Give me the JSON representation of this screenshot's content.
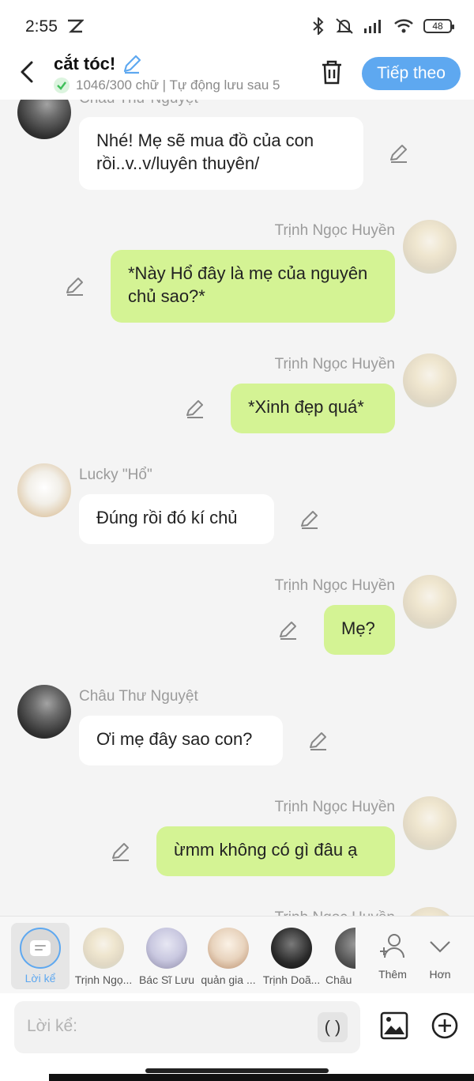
{
  "status_bar": {
    "time": "2:55",
    "battery": "48"
  },
  "header": {
    "title": "cắt tóc!",
    "subtitle": "1046/300 chữ | Tự động lưu sau 5",
    "next_button": "Tiếp theo"
  },
  "chat": {
    "top_partial_name": "Châu Thư Nguyệt",
    "messages": [
      {
        "side": "left",
        "name": "",
        "text": "Nhé! Mẹ sẽ mua đồ của con rồi..v..v/luyên thuyên/",
        "avatar": "avatar-dark"
      },
      {
        "side": "right",
        "name": "Trịnh Ngọc Huyền",
        "text": "*Này Hổ đây là mẹ của nguyên chủ sao?*",
        "avatar": "avatar-light"
      },
      {
        "side": "right",
        "name": "Trịnh Ngọc Huyền",
        "text": "*Xinh đẹp quá*",
        "avatar": "avatar-light"
      },
      {
        "side": "left",
        "name": "Lucky \"Hổ\"",
        "text": "Đúng rồi đó kí chủ",
        "avatar": "avatar-tiger"
      },
      {
        "side": "right",
        "name": "Trịnh Ngọc Huyền",
        "text": "Mẹ?",
        "avatar": "avatar-light"
      },
      {
        "side": "left",
        "name": "Châu Thư Nguyệt",
        "text": "Ơi mẹ đây sao con?",
        "avatar": "avatar-dark"
      },
      {
        "side": "right",
        "name": "Trịnh Ngọc Huyền",
        "text": "ừmm không có gì đâu ạ",
        "avatar": "avatar-light"
      }
    ],
    "bottom_partial_name": "Trịnh Ngọc Huyền"
  },
  "characters": [
    {
      "label": "Lời kể",
      "type": "narrator",
      "selected": true
    },
    {
      "label": "Trịnh Ngọ...",
      "color": "#efe5cc"
    },
    {
      "label": "Bác Sĩ Lưu",
      "color": "#c9c8e0"
    },
    {
      "label": "quản gia ...",
      "color": "#e8d3bd"
    },
    {
      "label": "Trịnh Doã...",
      "color": "#2a2a2a"
    },
    {
      "label": "Châu",
      "color": "#555555"
    }
  ],
  "char_actions": {
    "add_label": "Thêm",
    "more_label": "Hơn"
  },
  "input": {
    "placeholder": "Lời kể:",
    "paren": "( )"
  },
  "colors": {
    "accent": "#5ea8f0",
    "bubble_right": "#d4f394",
    "bubble_left": "#ffffff",
    "background": "#f4f4f4"
  },
  "icons": [
    "back-arrow-icon",
    "pencil-icon",
    "check-icon",
    "trash-icon",
    "edit-icon",
    "add-person-icon",
    "chevron-down-icon",
    "image-icon",
    "plus-circle-icon",
    "bluetooth-icon",
    "mute-icon",
    "signal-icon",
    "wifi-icon",
    "battery-icon"
  ]
}
